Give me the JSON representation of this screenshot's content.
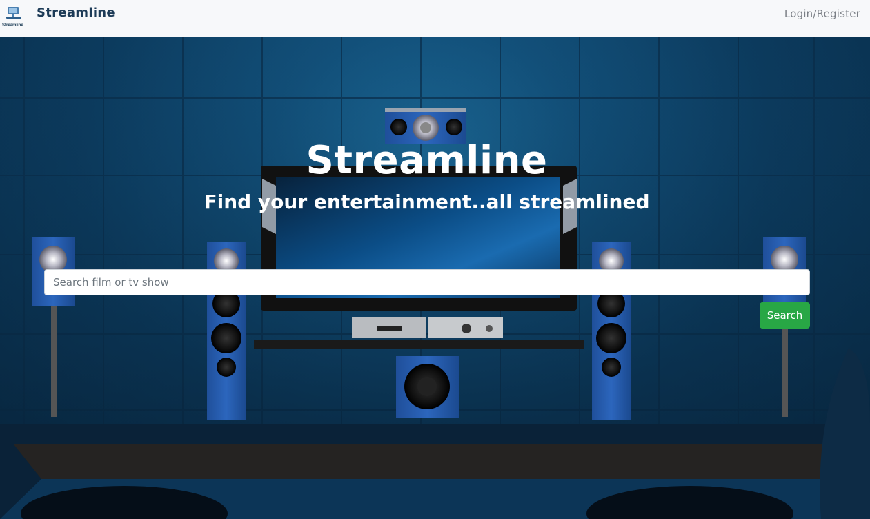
{
  "navbar": {
    "logo_text": "Streamline",
    "brand": "Streamline",
    "login_label": "Login/Register"
  },
  "hero": {
    "title": "Streamline",
    "subtitle": "Find your entertainment..all streamlined",
    "search_placeholder": "Search film or tv show",
    "search_value": "",
    "search_button_label": "Search",
    "colors": {
      "button": "#28a745",
      "background": "#0c3b5e"
    }
  },
  "icons": {
    "logo": "computer-monitor-icon"
  }
}
